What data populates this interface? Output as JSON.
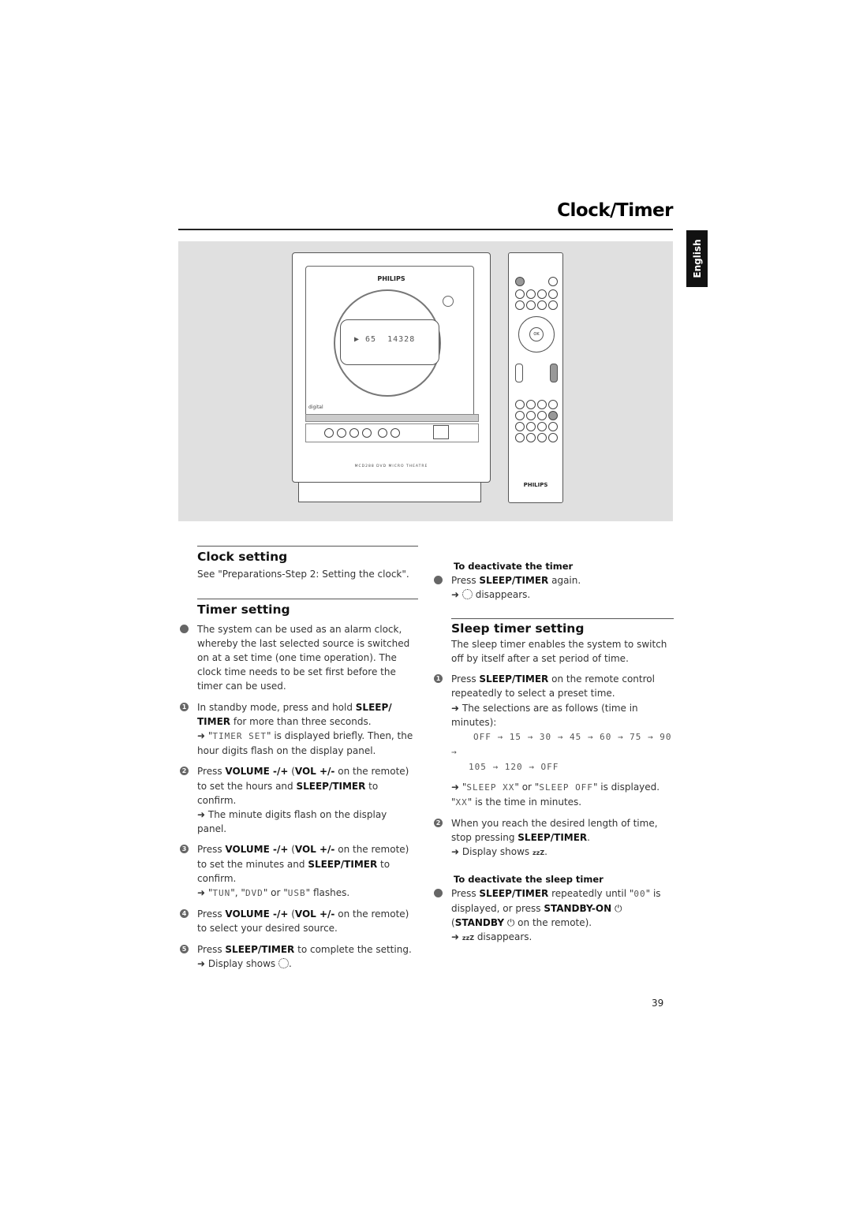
{
  "header": {
    "title": "Clock/Timer",
    "language_tab": "English"
  },
  "illustration": {
    "brand": "PHILIPS",
    "display_text": "▶ 65  14328",
    "model": "MCD288 DVD MICRO THEATRE",
    "remote_brand": "PHILIPS",
    "label_digital": "digital"
  },
  "clock_setting": {
    "heading": "Clock setting",
    "text": "See \"Preparations-Step 2: Setting the clock\"."
  },
  "timer_setting": {
    "heading": "Timer setting",
    "intro": "The system can be used as an alarm clock, whereby the last selected source is switched on at a set time (one time operation). The clock time needs to be set first before the timer can be used.",
    "steps": [
      {
        "num": "1",
        "a": "In standby mode, press and hold ",
        "b1": "SLEEP/ TIMER",
        "c": " for more than three seconds.",
        "result_pre": "➜ \"",
        "lcd": "TIMER SET",
        "result_post": "\" is displayed briefly. Then, the hour digits flash on the display panel."
      },
      {
        "num": "2",
        "a": "Press ",
        "b1": "VOLUME -/+",
        "c": " (",
        "b2": "VOL +/-",
        "d": " on the remote) to set the hours and ",
        "b3": "SLEEP/TIMER",
        "e": " to confirm.",
        "result": "➜ The minute digits flash on the display panel."
      },
      {
        "num": "3",
        "a": "Press ",
        "b1": "VOLUME -/+",
        "c": " (",
        "b2": "VOL +/-",
        "d": " on the remote) to set the minutes and ",
        "b3": "SLEEP/TIMER",
        "e": " to confirm.",
        "result_pre": "➜ \"",
        "lcd1": "TUN",
        "mid1": "\", \"",
        "lcd2": "DVD",
        "mid2": "\" or \"",
        "lcd3": "USB",
        "result_post": "\" flashes."
      },
      {
        "num": "4",
        "a": "Press ",
        "b1": "VOLUME -/+",
        "c": " (",
        "b2": "VOL +/-",
        "d": " on the remote) to select your desired source."
      },
      {
        "num": "5",
        "a": "Press ",
        "b1": "SLEEP/TIMER",
        "c": " to complete the setting.",
        "result": "➜ Display shows ",
        "icon": "timer-clock-icon"
      }
    ]
  },
  "deactivate_timer": {
    "heading": "To deactivate the timer",
    "a": "Press ",
    "b": "SLEEP/TIMER",
    "c": " again.",
    "result_post": " disappears.",
    "arrow": "➜"
  },
  "sleep_timer": {
    "heading": "Sleep timer setting",
    "intro": "The sleep timer enables the system to switch off by itself after a set period of time.",
    "step1": {
      "num": "1",
      "a": "Press ",
      "b": "SLEEP/TIMER",
      "c": " on the remote control repeatedly to select a preset time.",
      "result": "➜ The selections are as follows (time in minutes):",
      "sequence1": "OFF → 15 → 30 → 45 → 60 → 75 → 90 →",
      "sequence2": "105 → 120 → OFF",
      "r2_pre": "➜ \"",
      "lcd1": "SLEEP XX",
      "r2_mid": "\" or \"",
      "lcd2": "SLEEP OFF",
      "r2_post": "\" is displayed.",
      "r3_pre": "\"",
      "lcd3": "XX",
      "r3_post": "\" is the time in minutes."
    },
    "step2": {
      "num": "2",
      "a": "When you reach the desired length of time, stop pressing ",
      "b": "SLEEP/TIMER",
      "c": ".",
      "result": "➜ Display shows ",
      "zz": "zzZ",
      "end": "."
    }
  },
  "deactivate_sleep": {
    "heading": "To deactivate the sleep timer",
    "a": "Press ",
    "b": "SLEEP/TIMER",
    "c": " repeatedly until \"",
    "lcd": "00",
    "d": "\" is displayed, or press ",
    "b2": "STANDBY-ON",
    "e": " ⏻ (",
    "b3": "STANDBY",
    "f": " ⏻ on the remote).",
    "result_pre": "➜ ",
    "zz": "zzZ",
    "result_post": " disappears."
  },
  "page_number": "39"
}
